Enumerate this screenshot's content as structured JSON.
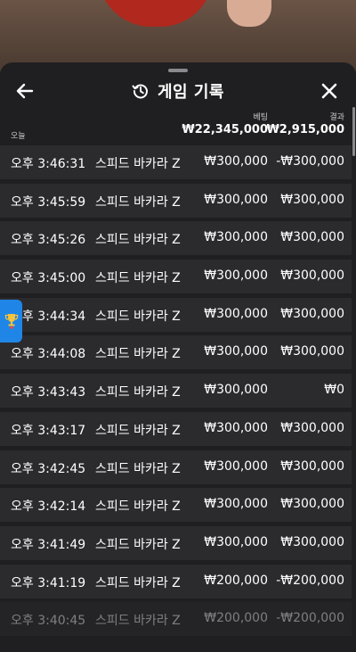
{
  "header": {
    "title": "게임 기록",
    "back_icon": "arrow-left-icon",
    "history_icon": "history-icon",
    "close_icon": "close-icon"
  },
  "summary": {
    "today_label": "오늘",
    "bet_label": "베팅",
    "result_label": "결과",
    "total_bet": "₩22,345,000",
    "total_result": "₩2,915,000"
  },
  "rows": [
    {
      "time": "오후 3:46:31",
      "game": "스피드 바카라 Z",
      "bet": "₩300,000",
      "result": "-₩300,000"
    },
    {
      "time": "오후 3:45:59",
      "game": "스피드 바카라 Z",
      "bet": "₩300,000",
      "result": "₩300,000"
    },
    {
      "time": "오후 3:45:26",
      "game": "스피드 바카라 Z",
      "bet": "₩300,000",
      "result": "₩300,000"
    },
    {
      "time": "오후 3:45:00",
      "game": "스피드 바카라 Z",
      "bet": "₩300,000",
      "result": "₩300,000"
    },
    {
      "time": "오후 3:44:34",
      "game": "스피드 바카라 Z",
      "bet": "₩300,000",
      "result": "₩300,000"
    },
    {
      "time": "오후 3:44:08",
      "game": "스피드 바카라 Z",
      "bet": "₩300,000",
      "result": "₩300,000"
    },
    {
      "time": "오후 3:43:43",
      "game": "스피드 바카라 Z",
      "bet": "₩300,000",
      "result": "₩0"
    },
    {
      "time": "오후 3:43:17",
      "game": "스피드 바카라 Z",
      "bet": "₩300,000",
      "result": "₩300,000"
    },
    {
      "time": "오후 3:42:45",
      "game": "스피드 바카라 Z",
      "bet": "₩300,000",
      "result": "₩300,000"
    },
    {
      "time": "오후 3:42:14",
      "game": "스피드 바카라 Z",
      "bet": "₩300,000",
      "result": "₩300,000"
    },
    {
      "time": "오후 3:41:49",
      "game": "스피드 바카라 Z",
      "bet": "₩300,000",
      "result": "₩300,000"
    },
    {
      "time": "오후 3:41:19",
      "game": "스피드 바카라 Z",
      "bet": "₩200,000",
      "result": "-₩200,000"
    },
    {
      "time": "오후 3:40:45",
      "game": "스피드 바카라 Z",
      "bet": "₩200,000",
      "result": "-₩200,000"
    }
  ],
  "side_tab": {
    "icon": "trophy-icon",
    "color": "#1f86e8"
  }
}
